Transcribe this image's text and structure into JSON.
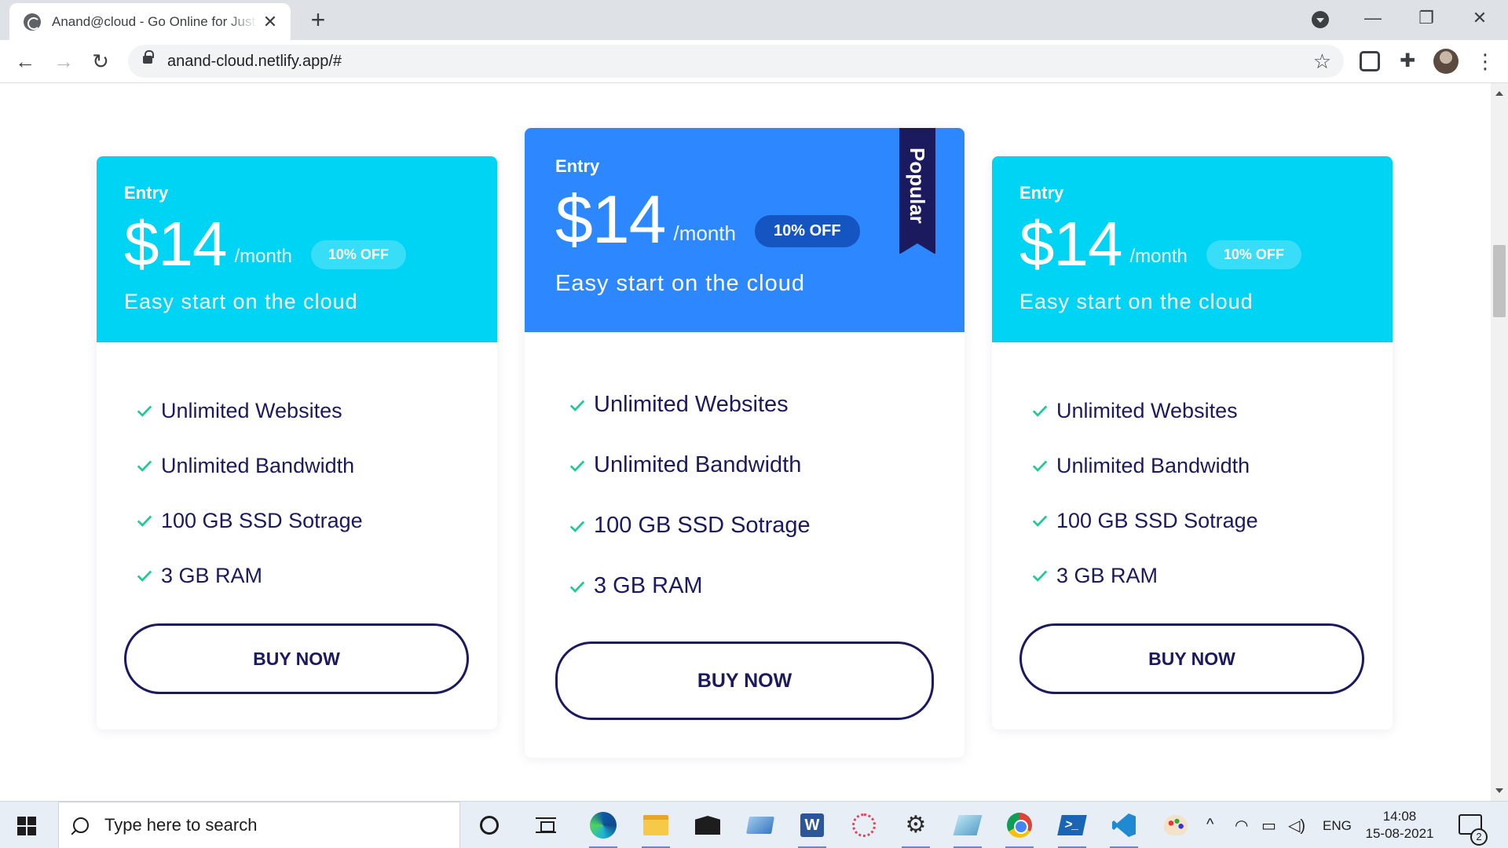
{
  "browser": {
    "tab_title": "Anand@cloud - Go Online for Just",
    "tab_close_icon": "close-icon",
    "new_tab_icon": "plus-icon",
    "url": "anand-cloud.netlify.app/#",
    "window_controls": {
      "minimize": "—",
      "restore": "❐",
      "close": "✕"
    }
  },
  "pricing": {
    "plans": [
      {
        "name": "Entry",
        "price": "$14",
        "period": "/month",
        "discount": "10% OFF",
        "tagline": "Easy start on the cloud",
        "features": [
          "Unlimited Websites",
          "Unlimited Bandwidth",
          "100 GB SSD Sotrage",
          "3 GB RAM"
        ],
        "button": "BUY NOW"
      },
      {
        "name": "Entry",
        "price": "$14",
        "period": "/month",
        "discount": "10% OFF",
        "tagline": "Easy start on the cloud",
        "ribbon": "Popular",
        "features": [
          "Unlimited Websites",
          "Unlimited Bandwidth",
          "100 GB SSD Sotrage",
          "3 GB RAM"
        ],
        "button": "BUY NOW"
      },
      {
        "name": "Entry",
        "price": "$14",
        "period": "/month",
        "discount": "10% OFF",
        "tagline": "Easy start on the cloud",
        "features": [
          "Unlimited Websites",
          "Unlimited Bandwidth",
          "100 GB SSD Sotrage",
          "3 GB RAM"
        ],
        "button": "BUY NOW"
      }
    ]
  },
  "colors": {
    "card_header": "#00d4f5",
    "featured_header": "#2d88ff",
    "navy": "#1b1a5e",
    "check": "#20c997"
  },
  "taskbar": {
    "search_placeholder": "Type here to search",
    "language": "ENG",
    "time": "14:08",
    "date": "15-08-2021",
    "notification_count": "2"
  }
}
